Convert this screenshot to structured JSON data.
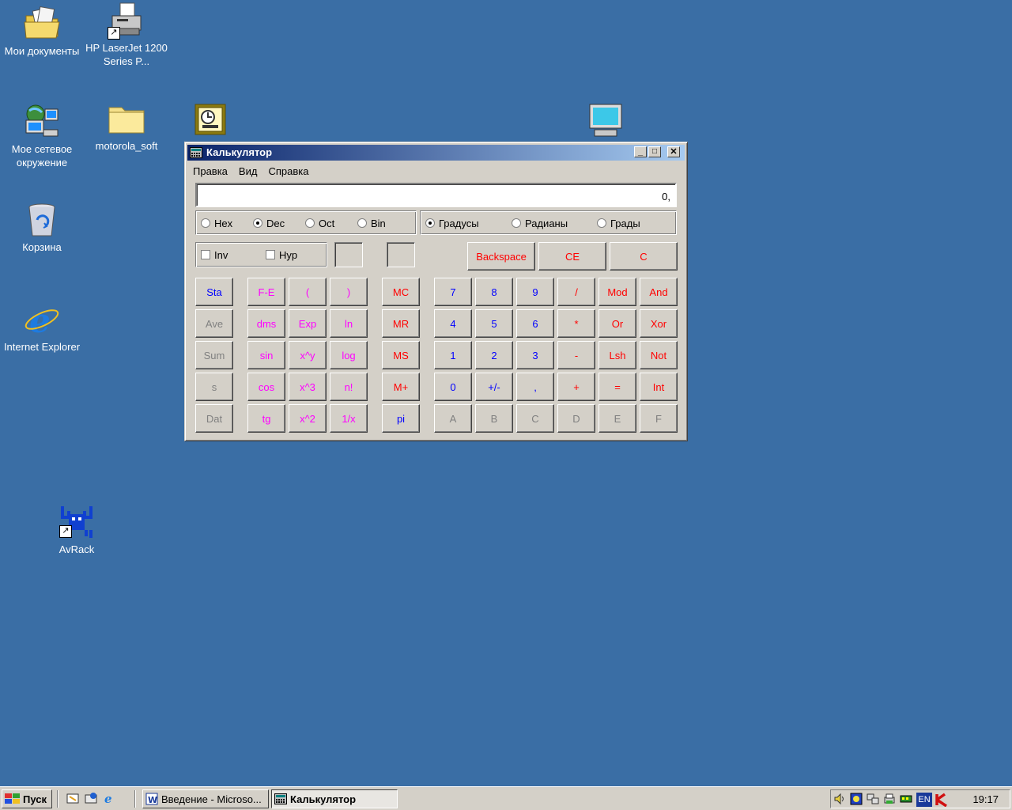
{
  "desktop": {
    "icons": [
      {
        "label": "Мои документы"
      },
      {
        "label": "HP LaserJet 1200 Series P..."
      },
      {
        "label": "Мое сетевое окружение"
      },
      {
        "label": "motorola_soft"
      },
      {
        "label": "Корзина"
      },
      {
        "label": "Internet Explorer"
      },
      {
        "label": "AvRack"
      }
    ]
  },
  "window": {
    "title": "Калькулятор",
    "buttons": {
      "minimize": "_",
      "maximize": "□",
      "close": "✕"
    },
    "menu": [
      "Правка",
      "Вид",
      "Справка"
    ],
    "display": "0,",
    "base_options": [
      "Hex",
      "Dec",
      "Oct",
      "Bin"
    ],
    "base_selected": "Dec",
    "angle_options": [
      "Градусы",
      "Радианы",
      "Грады"
    ],
    "angle_selected": "Градусы",
    "checks": [
      "Inv",
      "Hyp"
    ],
    "edit_buttons": [
      "Backspace",
      "CE",
      "C"
    ],
    "stat_buttons": [
      "Sta",
      "Ave",
      "Sum",
      "s",
      "Dat"
    ],
    "sci_buttons": [
      [
        "F-E",
        "(",
        ")"
      ],
      [
        "dms",
        "Exp",
        "ln"
      ],
      [
        "sin",
        "x^y",
        "log"
      ],
      [
        "cos",
        "x^3",
        "n!"
      ],
      [
        "tg",
        "x^2",
        "1/x"
      ]
    ],
    "mem_buttons": [
      "MC",
      "MR",
      "MS",
      "M+",
      "pi"
    ],
    "num_buttons": [
      [
        "7",
        "8",
        "9",
        "/",
        "Mod",
        "And"
      ],
      [
        "4",
        "5",
        "6",
        "*",
        "Or",
        "Xor"
      ],
      [
        "1",
        "2",
        "3",
        "-",
        "Lsh",
        "Not"
      ],
      [
        "0",
        "+/-",
        ",",
        "+",
        "=",
        "Int"
      ],
      [
        "A",
        "B",
        "C",
        "D",
        "E",
        "F"
      ]
    ]
  },
  "taskbar": {
    "start_label": "Пуск",
    "tasks": [
      "Введение - Microso...",
      "Калькулятор"
    ],
    "tray_lang": "EN",
    "clock": "19:17"
  },
  "colors": {
    "desktop": "#3A6EA5",
    "face": "#D4D0C8",
    "title_start": "#0A246A",
    "title_end": "#A6CAF0",
    "blue_key": "#0000FF",
    "red_key": "#FF0000",
    "magenta_key": "#FF00FF",
    "disabled_key": "#808080"
  }
}
